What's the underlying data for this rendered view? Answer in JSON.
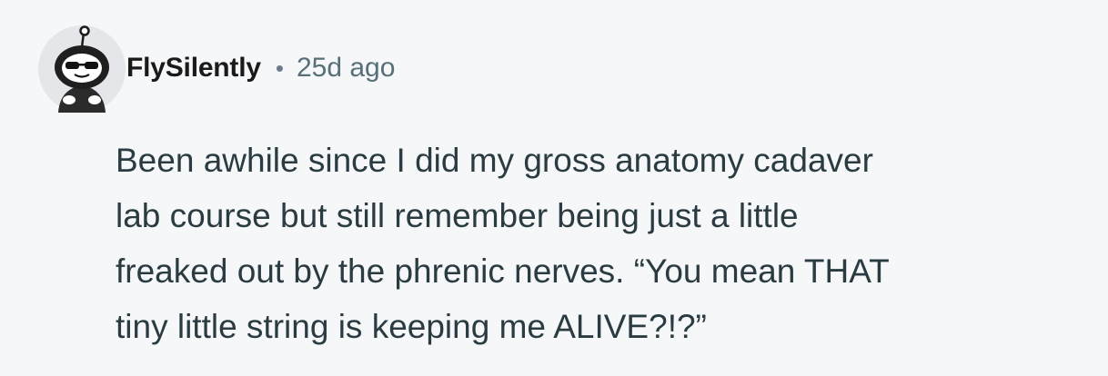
{
  "comment": {
    "author": "FlySilently",
    "separator": "•",
    "timestamp": "25d ago",
    "body_lines": [
      "Been awhile since I did my gross anatomy cadaver",
      "lab course but still remember being just a little",
      "freaked out by the phrenic nerves. “You mean THAT",
      "tiny little string is keeping me ALIVE?!?”"
    ]
  },
  "colors": {
    "background": "#f6f7f9",
    "username": "#1a1a1b",
    "meta": "#576f76",
    "body_text": "#2a3c42"
  },
  "icons": {
    "avatar": "snoo-avatar-with-sunglasses"
  }
}
